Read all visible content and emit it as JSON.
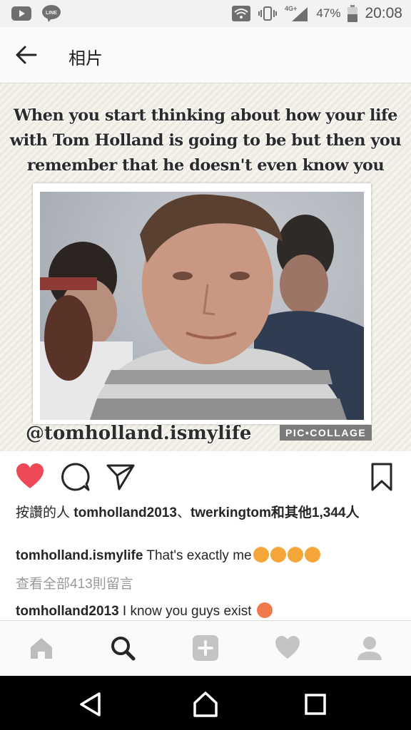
{
  "status_bar": {
    "network": "4G+",
    "battery_percent": "47%",
    "time": "20:08",
    "icons": [
      "youtube-icon",
      "line-icon",
      "wifi-icon",
      "vibrate-icon",
      "signal-icon",
      "battery-icon"
    ]
  },
  "header": {
    "title": "相片",
    "back_icon": "arrow-left-icon"
  },
  "photo": {
    "caption_lines": [
      "When you start thinking about how your life",
      "with Tom Holland is going to be but then you",
      "remember that he doesn't even know you exist."
    ],
    "watermark": "@tomholland.ismylife",
    "badge": "PIC•COLLAGE"
  },
  "actions": {
    "liked": true,
    "like_color": "#ed4956"
  },
  "likes": {
    "prefix": "按讚的人 ",
    "user1": "tomholland2013",
    "sep": "、",
    "user2": "twerkingtom",
    "suffix": "和其他1,344人"
  },
  "caption": {
    "username": "tomholland.ismylife",
    "text": " That's exactly me"
  },
  "view_all_comments": "查看全部413則留言",
  "comment": {
    "username": "tomholland2013",
    "text": " I know you guys exist "
  },
  "tabbar": {
    "items": [
      "home",
      "search",
      "add",
      "activity",
      "profile"
    ],
    "active": "search"
  }
}
